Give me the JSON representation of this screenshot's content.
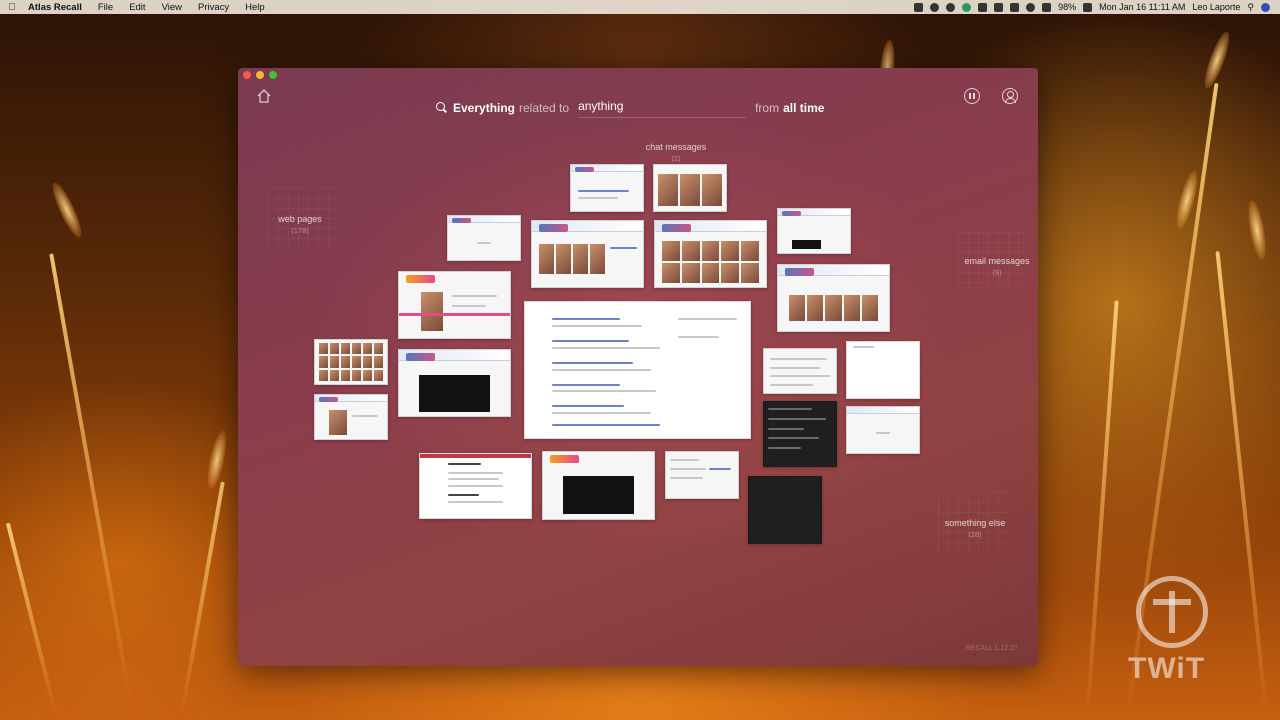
{
  "menubar": {
    "app_name": "Atlas Recall",
    "menus": [
      "File",
      "Edit",
      "View",
      "Privacy",
      "Help"
    ],
    "battery": "98%",
    "datetime": "Mon Jan 16  11:11 AM",
    "user": "Leo Laporte"
  },
  "query": {
    "type_label": "Everything",
    "related_to": "related to",
    "term": "anything",
    "from": "from",
    "time_range": "all time"
  },
  "categories": {
    "chat": {
      "label": "chat messages",
      "count": "(2)"
    },
    "web": {
      "label": "web pages",
      "count": "(178)"
    },
    "email": {
      "label": "email messages",
      "count": "(9)"
    },
    "else": {
      "label": "something else",
      "count": "(28)"
    }
  },
  "footer": {
    "version": "RECALL 1.12.27"
  },
  "watermark": {
    "text": "TWiT"
  },
  "icons": {
    "home": "home-icon",
    "pause": "pause-icon",
    "account": "account-icon",
    "search": "search-icon"
  }
}
